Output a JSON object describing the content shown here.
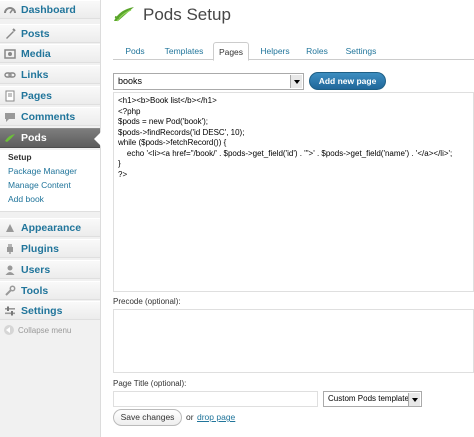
{
  "sidebar": {
    "items": [
      {
        "label": "Dashboard",
        "icon": "dashboard-icon"
      },
      {
        "label": "Posts",
        "icon": "posts-icon"
      },
      {
        "label": "Media",
        "icon": "media-icon"
      },
      {
        "label": "Links",
        "icon": "links-icon"
      },
      {
        "label": "Pages",
        "icon": "pages-icon"
      },
      {
        "label": "Comments",
        "icon": "comments-icon"
      },
      {
        "label": "Pods",
        "icon": "pods-icon",
        "active": true
      },
      {
        "label": "Appearance",
        "icon": "appearance-icon"
      },
      {
        "label": "Plugins",
        "icon": "plugins-icon"
      },
      {
        "label": "Users",
        "icon": "users-icon"
      },
      {
        "label": "Tools",
        "icon": "tools-icon"
      },
      {
        "label": "Settings",
        "icon": "settings-icon"
      }
    ],
    "submenu": [
      "Setup",
      "Package Manager",
      "Manage Content",
      "Add book"
    ],
    "collapse_label": "Collapse menu"
  },
  "header": {
    "title": "Pods Setup",
    "logo": "pods-logo-icon"
  },
  "tabs": [
    {
      "label": "Pods"
    },
    {
      "label": "Templates"
    },
    {
      "label": "Pages",
      "active": true
    },
    {
      "label": "Helpers"
    },
    {
      "label": "Roles"
    },
    {
      "label": "Settings"
    }
  ],
  "page_select": {
    "value": "books"
  },
  "add_button": {
    "label": "Add new page"
  },
  "code": {
    "content": "<h1><b>Book list</b></h1>\n<?php\n$pods = new Pod('book');\n$pods->findRecords('id DESC', 10);\nwhile ($pods->fetchRecord()) {\n    echo '<li><a href=\"/book/' . $pods->get_field('id') . '\">' . $pods->get_field('name') . '</a></li>';\n}\n?>"
  },
  "precode": {
    "label": "Precode (optional):",
    "value": ""
  },
  "page_title": {
    "label": "Page Title (optional):",
    "value": ""
  },
  "template_select": {
    "value": "Custom Pods template"
  },
  "actions": {
    "save_label": "Save changes",
    "or_text": "or",
    "drop_label": "drop page"
  },
  "colors": {
    "link": "#21759b",
    "primary_button": "#21679a",
    "active_menu": "#6d6d6d",
    "pods_logo": "#5aa52b"
  }
}
